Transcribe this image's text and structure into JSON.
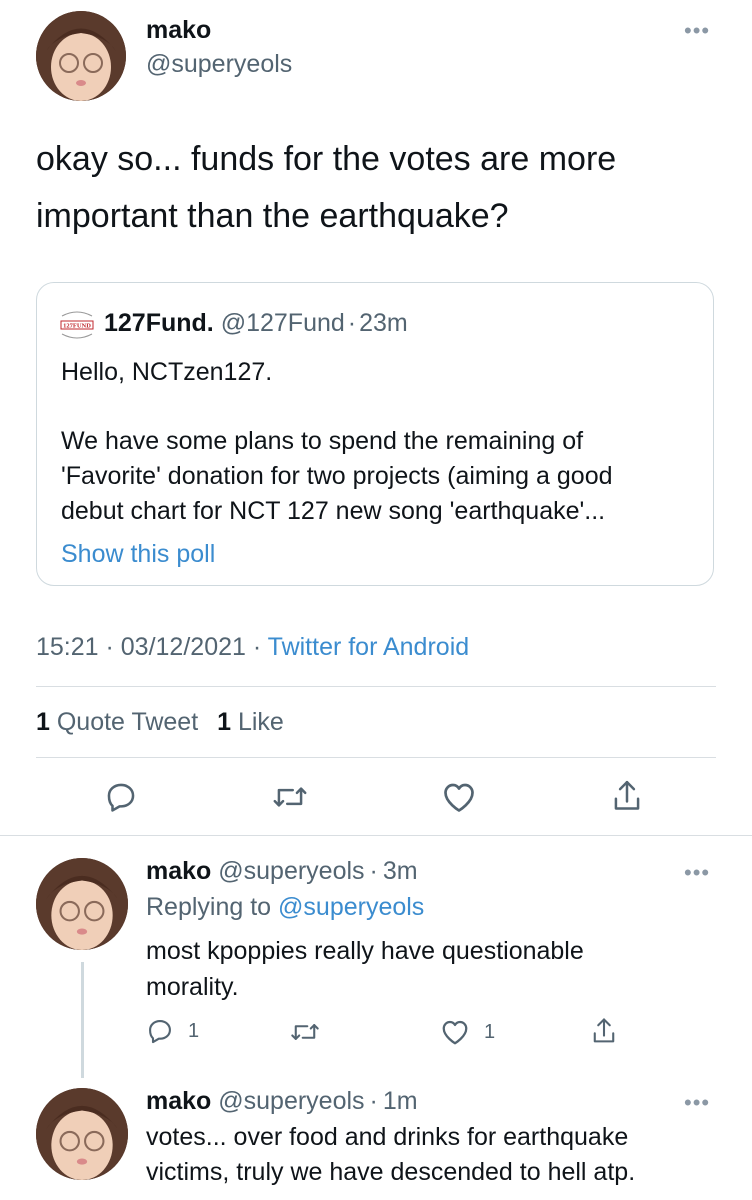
{
  "main_tweet": {
    "display_name": "mako",
    "handle": "@superyeols",
    "text_line1": "okay so... funds for the votes are more",
    "text_line2": "important than the earthquake?",
    "quoted": {
      "account_name": "127Fund.",
      "handle": "@127Fund",
      "sep": "·",
      "time": "23m",
      "greeting": "Hello, NCTzen127.",
      "body_line1": "We have some plans to spend the remaining of",
      "body_line2": "'Favorite' donation for two projects (aiming a good",
      "body_line3": "debut chart for NCT 127 new song 'earthquake'...",
      "poll_link": "Show this poll",
      "logo_text": "127FUND"
    },
    "timestamp": "15:21 · 03/12/2021 ·",
    "source": "Twitter for Android",
    "quote_count": "1",
    "quote_label": "Quote Tweet",
    "like_count": "1",
    "like_label": "Like"
  },
  "replies": [
    {
      "display_name": "mako",
      "handle": "@superyeols",
      "sep": "·",
      "time": "3m",
      "replying_prefix": "Replying to",
      "replying_to": "@superyeols",
      "text_line1": "most kpoppies really have questionable",
      "text_line2": "morality.",
      "reply_count": "1",
      "like_count": "1"
    },
    {
      "display_name": "mako",
      "handle": "@superyeols",
      "sep": "·",
      "time": "1m",
      "text_line1": "votes... over food and drinks for earthquake",
      "text_line2": "victims, truly we have descended to hell atp."
    }
  ],
  "icons": [
    "more-icon",
    "reply-icon",
    "retweet-icon",
    "like-icon",
    "share-icon",
    "127fund-logo"
  ],
  "colors": {
    "link": "#3b8ccf",
    "muted": "#536471",
    "text": "#0f1419",
    "divider": "#d9dee2"
  }
}
